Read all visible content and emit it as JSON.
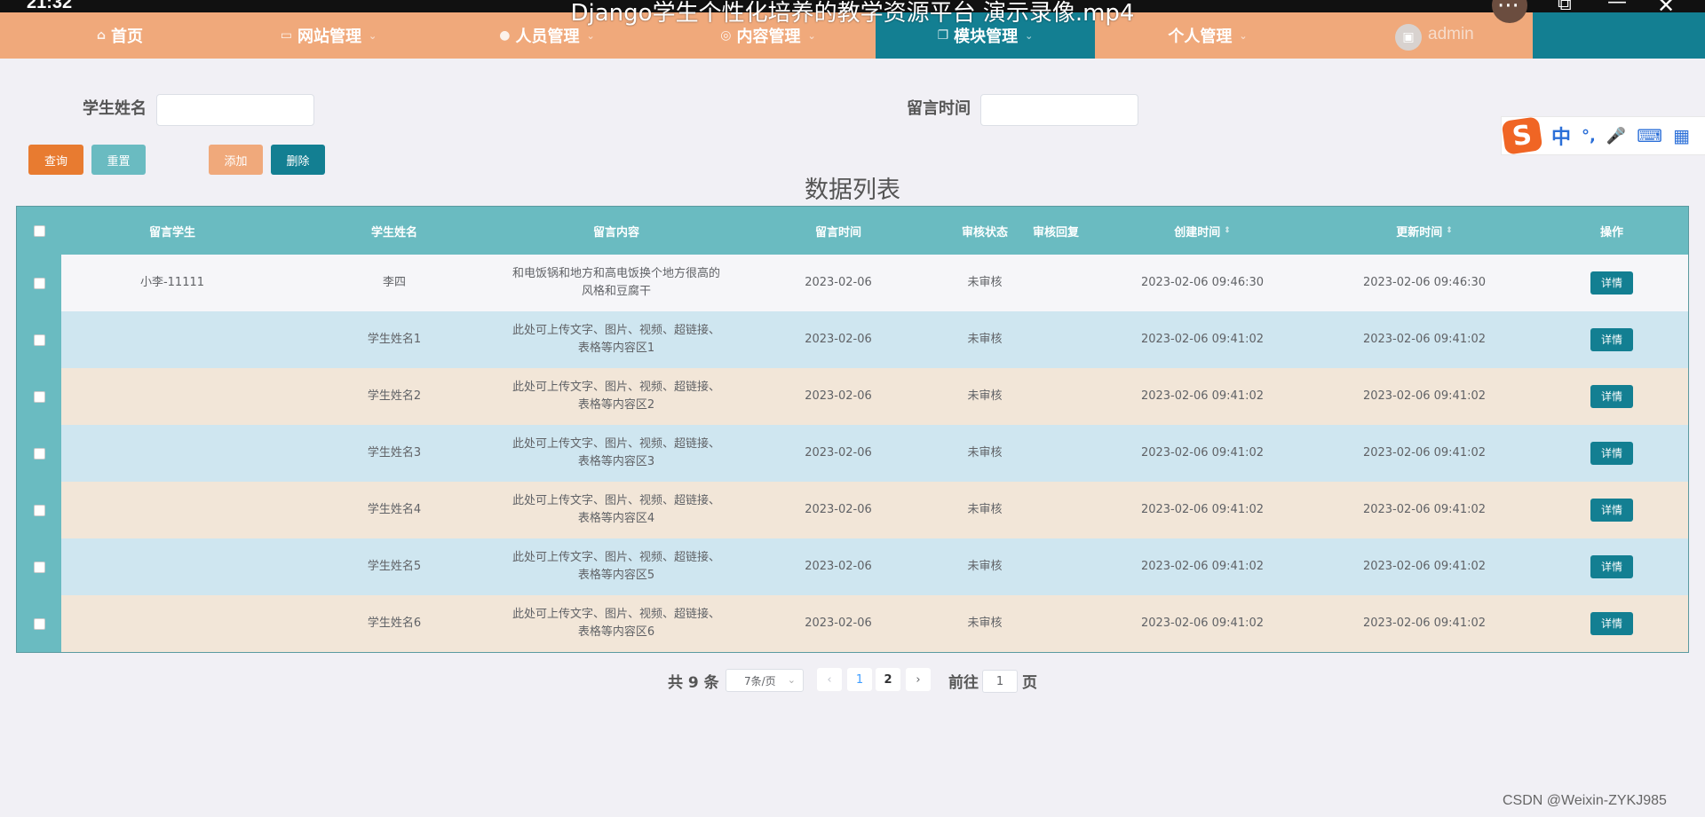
{
  "video": {
    "time": "21:32",
    "title": "Django学生个性化培养的教学资源平台 演示录像.mp4",
    "controls": {
      "more": "···",
      "restore": "⧉",
      "minimize": "—",
      "close": "✕"
    }
  },
  "nav": {
    "items": [
      {
        "label": "首页",
        "icon": "home-icon",
        "glyph": "⌂"
      },
      {
        "label": "网站管理",
        "icon": "monitor-icon",
        "glyph": "▭"
      },
      {
        "label": "人员管理",
        "icon": "user-icon",
        "glyph": "●"
      },
      {
        "label": "内容管理",
        "icon": "circle-icon",
        "glyph": "◎"
      },
      {
        "label": "模块管理",
        "icon": "copy-icon",
        "glyph": "❐"
      },
      {
        "label": "个人管理",
        "icon": "",
        "glyph": ""
      }
    ],
    "active_index": 4,
    "user": "admin"
  },
  "search": {
    "student_name_label": "学生姓名",
    "message_time_label": "留言时间",
    "query_button": "查询",
    "reset_button": "重置",
    "add_button": "添加",
    "delete_button": "删除"
  },
  "heading": "数据列表",
  "table": {
    "headers": {
      "message_student": "留言学生",
      "student_name": "学生姓名",
      "message_content": "留言内容",
      "message_time": "留言时间",
      "review_status": "审核状态",
      "review_reply": "审核回复",
      "created_time": "创建时间",
      "updated_time": "更新时间",
      "actions": "操作"
    },
    "rows": [
      {
        "message_student": "小李-11111",
        "student_name": "李四",
        "content_line1": "和电饭锅和地方和高电饭换个地方很高的",
        "content_line2": "风格和豆腐干",
        "message_time": "2023-02-06",
        "review_status": "未审核",
        "review_reply": "",
        "created_time": "2023-02-06 09:46:30",
        "updated_time": "2023-02-06 09:46:30",
        "action": "详情"
      },
      {
        "message_student": "",
        "student_name": "学生姓名1",
        "content_line1": "此处可上传文字、图片、视频、超链接、",
        "content_line2": "表格等内容区1",
        "message_time": "2023-02-06",
        "review_status": "未审核",
        "review_reply": "",
        "created_time": "2023-02-06 09:41:02",
        "updated_time": "2023-02-06 09:41:02",
        "action": "详情"
      },
      {
        "message_student": "",
        "student_name": "学生姓名2",
        "content_line1": "此处可上传文字、图片、视频、超链接、",
        "content_line2": "表格等内容区2",
        "message_time": "2023-02-06",
        "review_status": "未审核",
        "review_reply": "",
        "created_time": "2023-02-06 09:41:02",
        "updated_time": "2023-02-06 09:41:02",
        "action": "详情"
      },
      {
        "message_student": "",
        "student_name": "学生姓名3",
        "content_line1": "此处可上传文字、图片、视频、超链接、",
        "content_line2": "表格等内容区3",
        "message_time": "2023-02-06",
        "review_status": "未审核",
        "review_reply": "",
        "created_time": "2023-02-06 09:41:02",
        "updated_time": "2023-02-06 09:41:02",
        "action": "详情"
      },
      {
        "message_student": "",
        "student_name": "学生姓名4",
        "content_line1": "此处可上传文字、图片、视频、超链接、",
        "content_line2": "表格等内容区4",
        "message_time": "2023-02-06",
        "review_status": "未审核",
        "review_reply": "",
        "created_time": "2023-02-06 09:41:02",
        "updated_time": "2023-02-06 09:41:02",
        "action": "详情"
      },
      {
        "message_student": "",
        "student_name": "学生姓名5",
        "content_line1": "此处可上传文字、图片、视频、超链接、",
        "content_line2": "表格等内容区5",
        "message_time": "2023-02-06",
        "review_status": "未审核",
        "review_reply": "",
        "created_time": "2023-02-06 09:41:02",
        "updated_time": "2023-02-06 09:41:02",
        "action": "详情"
      },
      {
        "message_student": "",
        "student_name": "学生姓名6",
        "content_line1": "此处可上传文字、图片、视频、超链接、",
        "content_line2": "表格等内容区6",
        "message_time": "2023-02-06",
        "review_status": "未审核",
        "review_reply": "",
        "created_time": "2023-02-06 09:41:02",
        "updated_time": "2023-02-06 09:41:02",
        "action": "详情"
      }
    ]
  },
  "pagination": {
    "total": "共 9 条",
    "page_size": "7条/页",
    "pages": [
      "1",
      "2"
    ],
    "current_page": "1",
    "goto_label": "前往",
    "goto_value": "1",
    "page_suffix": "页"
  },
  "ime": {
    "items": [
      "中",
      "°,",
      "🎤",
      "⌨",
      "▦"
    ]
  },
  "watermark": "CSDN @Weixin-ZYKJ985",
  "colors": {
    "nav_bg": "#f0a97b",
    "nav_active": "#137f92",
    "table_header": "#6abbc1",
    "row_alt_blue": "#cfe6f0",
    "row_alt_beige": "#f2e6d8",
    "query_button": "#e87b30",
    "reset_button": "#6abbc1",
    "add_button": "#f0a97b",
    "delete_button": "#137f92"
  }
}
